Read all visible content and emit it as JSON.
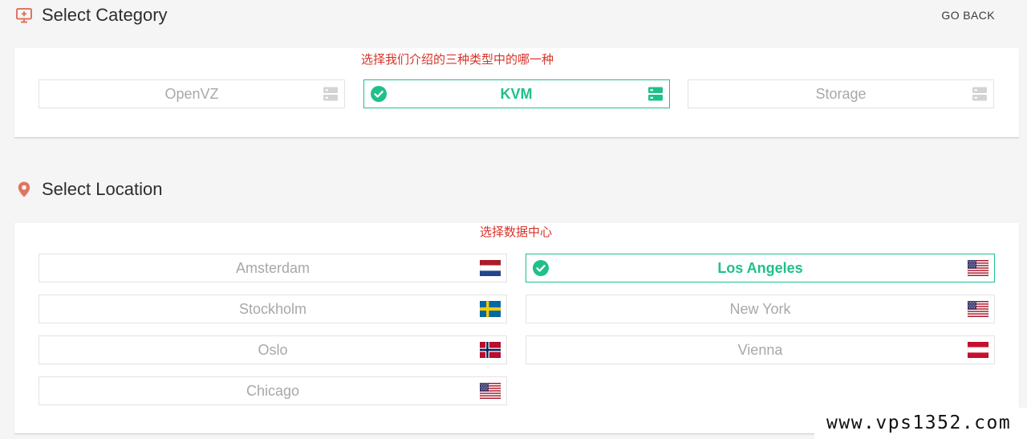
{
  "colors": {
    "accent": "#20c08a",
    "annotation": "#d6332a",
    "muted_text": "#a8a8a8",
    "section_icon": "#e07560"
  },
  "category": {
    "title": "Select Category",
    "title_icon": "monitor-plus-icon",
    "go_back_label": "GO BACK",
    "annotation": "选择我们介绍的三种类型中的哪一种",
    "options": [
      {
        "label": "OpenVZ",
        "icon": "server-icon",
        "selected": false
      },
      {
        "label": "KVM",
        "icon": "server-icon",
        "selected": true
      },
      {
        "label": "Storage",
        "icon": "server-icon",
        "selected": false
      }
    ]
  },
  "location": {
    "title": "Select Location",
    "title_icon": "map-pin-icon",
    "annotation": "选择数据中心",
    "options": [
      {
        "label": "Amsterdam",
        "icon": "flag-netherlands-icon",
        "selected": false
      },
      {
        "label": "Los Angeles",
        "icon": "flag-united-states-icon",
        "selected": true
      },
      {
        "label": "Stockholm",
        "icon": "flag-sweden-icon",
        "selected": false
      },
      {
        "label": "New York",
        "icon": "flag-united-states-icon",
        "selected": false
      },
      {
        "label": "Oslo",
        "icon": "flag-norway-icon",
        "selected": false
      },
      {
        "label": "Vienna",
        "icon": "flag-austria-icon",
        "selected": false
      },
      {
        "label": "Chicago",
        "icon": "flag-united-states-icon",
        "selected": false
      }
    ]
  },
  "watermark": "www.vps1352.com"
}
